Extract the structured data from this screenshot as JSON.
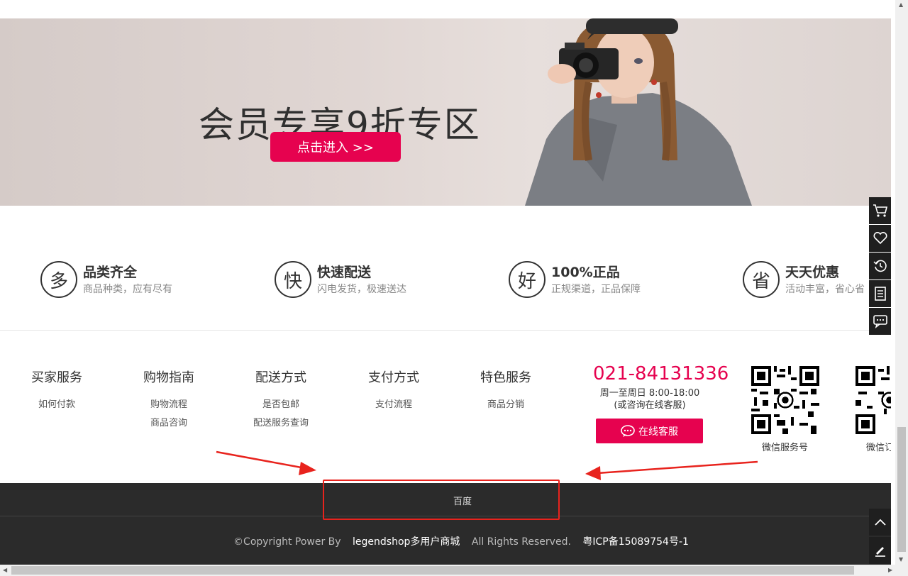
{
  "banner": {
    "title": "会员专享9折专区",
    "button_label": "点击进入 >>"
  },
  "features": [
    {
      "icon_char": "多",
      "title": "品类齐全",
      "subtitle": "商品种类，应有尽有"
    },
    {
      "icon_char": "快",
      "title": "快速配送",
      "subtitle": "闪电发货，极速送达"
    },
    {
      "icon_char": "好",
      "title": "100%正品",
      "subtitle": "正规渠道，正品保障"
    },
    {
      "icon_char": "省",
      "title": "天天优惠",
      "subtitle": "活动丰富，省心省"
    }
  ],
  "footer_columns": [
    {
      "title": "买家服务",
      "links": [
        "如何付款"
      ]
    },
    {
      "title": "购物指南",
      "links": [
        "购物流程",
        "商品咨询"
      ]
    },
    {
      "title": "配送方式",
      "links": [
        "是否包邮",
        "配送服务查询"
      ]
    },
    {
      "title": "支付方式",
      "links": [
        "支付流程"
      ]
    },
    {
      "title": "特色服务",
      "links": [
        "商品分销"
      ]
    }
  ],
  "contact": {
    "phone": "021-84131336",
    "hours_line1": "周一至周日 8:00-18:00",
    "hours_line2": "(或咨询在线客服)",
    "cs_button": "在线客服"
  },
  "qr_codes": [
    {
      "label": "微信服务号"
    },
    {
      "label": "微信订"
    }
  ],
  "footer_bottom": {
    "friend_link": "百度",
    "copyright_prefix": "©Copyright Power By",
    "brand": "legendshop多用户商城",
    "rights": "All Rights Reserved.",
    "icp": "粤ICP备15089754号-1"
  },
  "sidebar": {
    "items": [
      "cart-icon",
      "heart-icon",
      "history-icon",
      "document-icon",
      "message-icon"
    ],
    "bottom": [
      "arrow-up-icon",
      "edit-icon"
    ]
  },
  "colors": {
    "accent": "#e6024f",
    "footer_bg": "#2b2b2b",
    "annotation": "#e8231d"
  }
}
